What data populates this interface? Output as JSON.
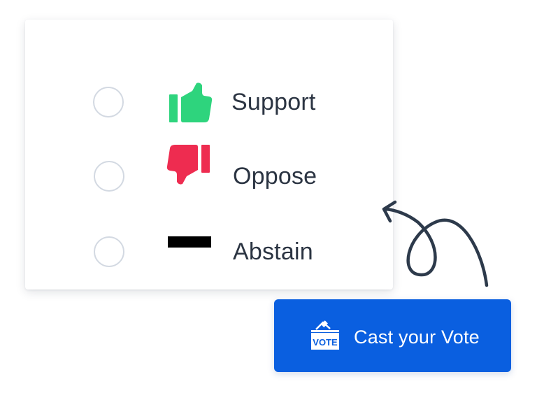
{
  "options": [
    {
      "label": "Support",
      "icon": "thumbs-up-icon",
      "color": "#2ed47d"
    },
    {
      "label": "Oppose",
      "icon": "thumbs-down-icon",
      "color": "#ee2c50"
    },
    {
      "label": "Abstain",
      "icon": "dash-icon",
      "color": "#000000"
    }
  ],
  "cta": {
    "label": "Cast your Vote",
    "icon": "ballot-box-icon",
    "icon_text": "VOTE",
    "color": "#0a5fe0"
  },
  "arrow": {
    "color": "#2d3a4b",
    "icon": "curved-arrow-icon"
  }
}
